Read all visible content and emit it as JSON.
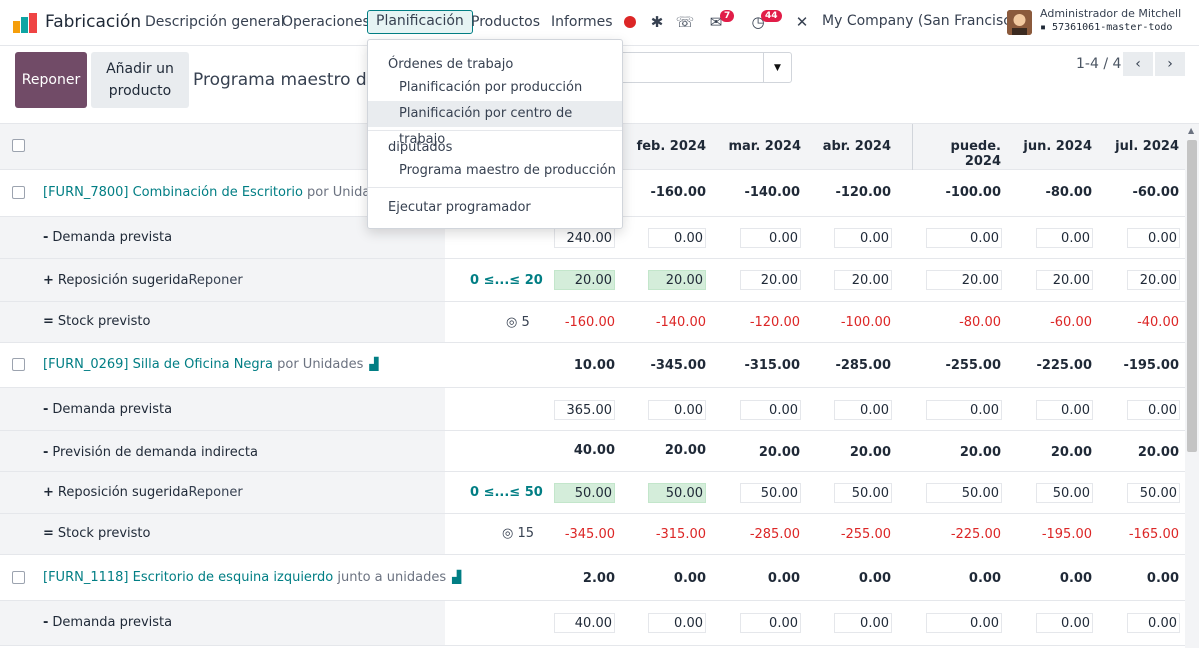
{
  "nav": {
    "app_name": "Fabricación",
    "menus": [
      "Descripción general",
      "Operaciones",
      "Planificación",
      "Productos",
      "Informes"
    ],
    "active_menu": "Planificación",
    "badges": {
      "messages": "7",
      "activities": "44"
    },
    "company": "My Company (San Francisco)",
    "user": "Administrador de Mitchell",
    "database": "57361061-master-todo"
  },
  "control": {
    "primary_button": "Reponer",
    "secondary_button": "Añadir un producto",
    "title": "Programa maestro de producción",
    "pager": "1-4 / 4"
  },
  "dropdown": {
    "section1": "Órdenes de trabajo",
    "item1": "Planificación por producción",
    "item2": "Planificación por centro de trabajo",
    "section2": "diputados",
    "item3": "Programa maestro de producción",
    "item4": "Ejecutar programador"
  },
  "grid": {
    "months": [
      "feb. 2024",
      "mar. 2024",
      "abr. 2024",
      "puede. 2024",
      "jun. 2024",
      "jul. 2024"
    ],
    "products": [
      {
        "name": "[FURN_7800] Combinación de Escritorio",
        "uom": "por Unidades",
        "row_values": [
          "",
          "-160.00",
          "-140.00",
          "-120.00",
          "-100.00",
          "-80.00",
          "-60.00"
        ],
        "demand_label": "Demanda prevista",
        "demand": [
          "240.00",
          "0.00",
          "0.00",
          "0.00",
          "0.00",
          "0.00",
          "0.00"
        ],
        "replenish_label": "Reposición sugerida",
        "replenish_action": "Reponer",
        "min_max": "0 ≤...≤ 20",
        "replenish": [
          "20.00",
          "20.00",
          "20.00",
          "20.00",
          "20.00",
          "20.00",
          "20.00"
        ],
        "stock_label": "Stock previsto",
        "safety_stock": "5",
        "stock": [
          "-160.00",
          "-140.00",
          "-120.00",
          "-100.00",
          "-80.00",
          "-60.00",
          "-40.00"
        ]
      },
      {
        "name": "[FURN_0269] Silla de Oficina Negra",
        "uom": "por Unidades",
        "row_values": [
          "10.00",
          "-345.00",
          "-315.00",
          "-285.00",
          "-255.00",
          "-225.00",
          "-195.00"
        ],
        "demand_label": "Demanda prevista",
        "demand": [
          "365.00",
          "0.00",
          "0.00",
          "0.00",
          "0.00",
          "0.00",
          "0.00"
        ],
        "indirect_label": "Previsión de demanda indirecta",
        "indirect": [
          "40.00",
          "20.00",
          "20.00",
          "20.00",
          "20.00",
          "20.00",
          "20.00"
        ],
        "replenish_label": "Reposición sugerida",
        "replenish_action": "Reponer",
        "min_max": "0 ≤...≤ 50",
        "replenish": [
          "50.00",
          "50.00",
          "50.00",
          "50.00",
          "50.00",
          "50.00",
          "50.00"
        ],
        "stock_label": "Stock previsto",
        "safety_stock": "15",
        "stock": [
          "-345.00",
          "-315.00",
          "-285.00",
          "-255.00",
          "-225.00",
          "-195.00",
          "-165.00"
        ]
      },
      {
        "name": "[FURN_1118] Escritorio de esquina izquierdo",
        "uom": "junto a unidades",
        "row_values": [
          "2.00",
          "0.00",
          "0.00",
          "0.00",
          "0.00",
          "0.00",
          "0.00"
        ],
        "demand_label": "Demanda prevista",
        "demand": [
          "40.00",
          "0.00",
          "0.00",
          "0.00",
          "0.00",
          "0.00",
          "0.00"
        ]
      }
    ]
  }
}
